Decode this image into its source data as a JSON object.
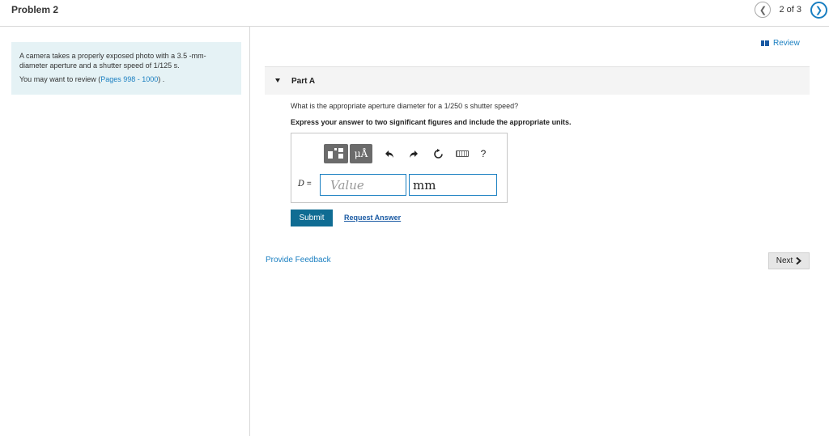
{
  "header": {
    "title": "Problem 2",
    "pager": {
      "prev_icon": "chevron-left-icon",
      "count": "2 of 3",
      "next_icon": "chevron-right-icon"
    }
  },
  "sidebar": {
    "problem_text": "A camera takes a properly exposed photo with a 3.5 -mm-diameter aperture and a shutter speed of 1/125 s.",
    "review_prefix": "You may want to review (",
    "review_link": "Pages 998 - 1000",
    "review_suffix": ") ."
  },
  "review": {
    "label": "Review",
    "icon": "review-bars-icon"
  },
  "part": {
    "title": "Part A",
    "question": "What is the appropriate aperture diameter for a 1/250 s shutter speed?",
    "instruction": "Express your answer to two significant figures and include the appropriate units."
  },
  "answer": {
    "toolbar": {
      "templates_icon": "templates-icon",
      "units_label": "μÅ",
      "undo_icon": "undo-icon",
      "redo_icon": "redo-icon",
      "reset_icon": "reset-icon",
      "keyboard_icon": "keyboard-icon",
      "help_label": "?"
    },
    "variable": "D",
    "equals": "=",
    "value_placeholder": "Value",
    "unit_value": "mm"
  },
  "actions": {
    "submit": "Submit",
    "request_answer": "Request Answer",
    "feedback": "Provide Feedback",
    "next": "Next"
  },
  "colors": {
    "accent": "#1a7fc1",
    "submit_bg": "#0f6c93",
    "info_bg": "#e5f2f5"
  }
}
